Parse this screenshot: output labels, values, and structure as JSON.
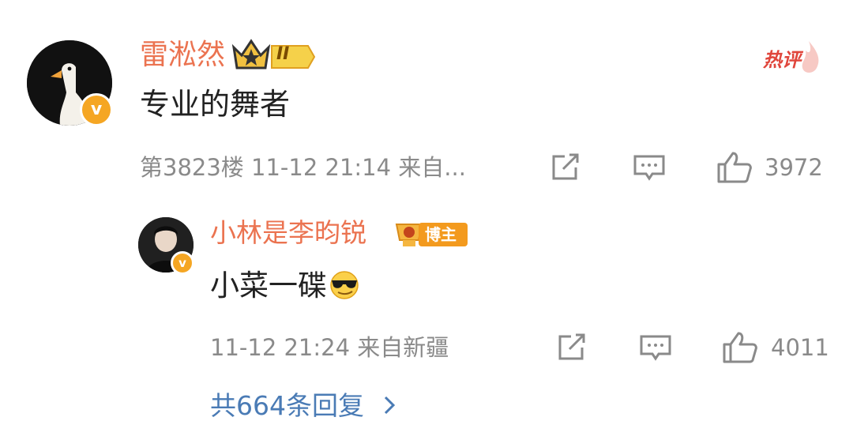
{
  "comment": {
    "author": "雷淞然",
    "badge_level": "II",
    "hot_label": "热评",
    "text": "专业的舞者",
    "meta": "第3823楼  11-12 21:14  来自...",
    "like_count": "3972",
    "share_icon": "share-icon",
    "reply_icon": "comment-icon",
    "like_icon": "thumbs-up-icon"
  },
  "reply": {
    "author": "小林是李昀锐",
    "badge_label": "博主",
    "text": "小菜一碟",
    "emoji": "sunglasses-emoji",
    "meta": "11-12 21:24  来自新疆",
    "like_count": "4011"
  },
  "more": {
    "label": "共664条回复"
  },
  "colors": {
    "name": "#eb7350",
    "meta": "#8a8a8a",
    "link": "#4a7bb5",
    "hot": "#e0463c",
    "verified": "#f5a623"
  }
}
